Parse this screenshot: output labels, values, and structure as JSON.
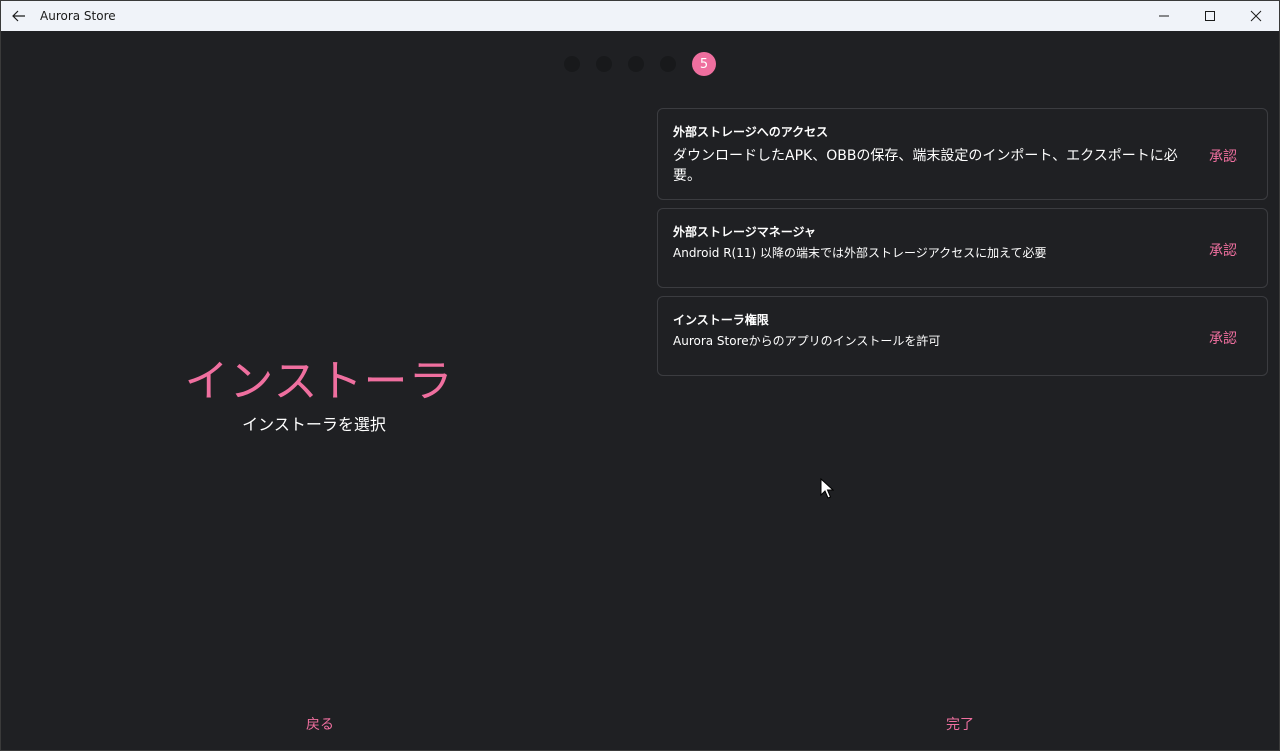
{
  "window": {
    "title": "Aurora Store"
  },
  "steps": {
    "active_label": "5"
  },
  "hero": {
    "title": "インストーラ",
    "subtitle": "インストーラを選択"
  },
  "permissions": [
    {
      "title": "外部ストレージへのアクセス",
      "description": "ダウンロードしたAPK、OBBの保存、端末設定のインポート、エクスポートに必要。",
      "action": "承認"
    },
    {
      "title": "外部ストレージマネージャ",
      "description": "Android R(11) 以降の端末では外部ストレージアクセスに加えて必要",
      "action": "承認"
    },
    {
      "title": "インストーラ権限",
      "description": "Aurora Storeからのアプリのインストールを許可",
      "action": "承認"
    }
  ],
  "nav": {
    "back_label": "戻る",
    "done_label": "完了"
  },
  "colors": {
    "accent": "#ef6f9f",
    "background": "#1f2023",
    "titlebar": "#f0f3f9"
  }
}
